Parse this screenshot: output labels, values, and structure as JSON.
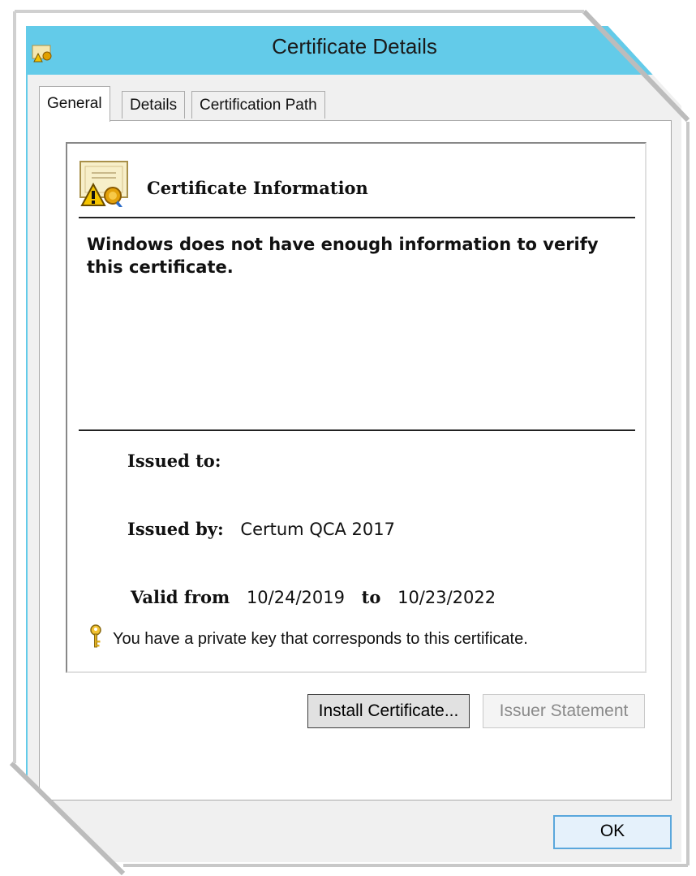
{
  "window": {
    "title": "Certificate Details",
    "accent_color": "#63cbe9",
    "icon": "certificate-icon"
  },
  "tabs": [
    {
      "label": "General",
      "active": true
    },
    {
      "label": "Details",
      "active": false
    },
    {
      "label": "Certification Path",
      "active": false
    }
  ],
  "info": {
    "heading": "Certificate Information",
    "icon": "certificate-warning-icon",
    "warning": "Windows does not have enough information to verify this certificate."
  },
  "fields": {
    "issued_to_label": "Issued to:",
    "issued_to_value": "",
    "issued_by_label": "Issued by:",
    "issued_by_value": "Certum QCA 2017",
    "valid_from_label": "Valid from",
    "valid_from_value": "10/24/2019",
    "to_label": "to",
    "valid_to_value": "10/23/2022"
  },
  "private_key": {
    "icon": "key-icon",
    "text": "You have a private key that corresponds to this certificate."
  },
  "buttons": {
    "install": "Install Certificate...",
    "issuer_statement": "Issuer Statement",
    "ok": "OK"
  }
}
